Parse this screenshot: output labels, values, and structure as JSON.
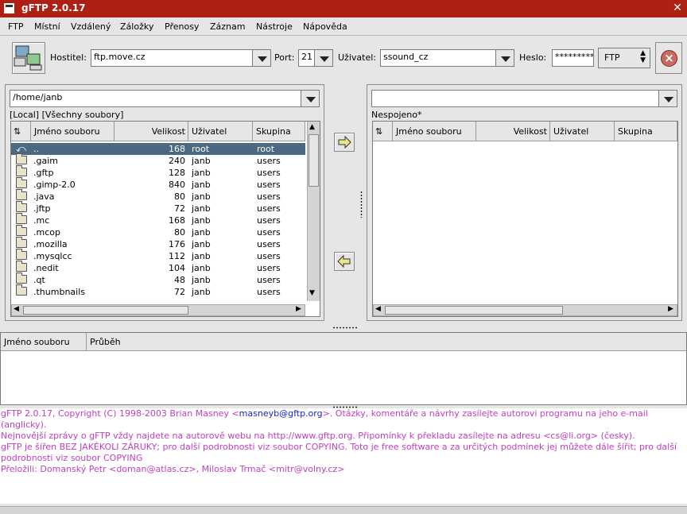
{
  "window": {
    "title": "gFTP 2.0.17"
  },
  "menu": [
    "FTP",
    "Místní",
    "Vzdálený",
    "Záložky",
    "Přenosy",
    "Záznam",
    "Nástroje",
    "Nápověda"
  ],
  "toolbar": {
    "host_label": "Hostitel:",
    "host_value": "ftp.move.cz",
    "port_label": "Port:",
    "port_value": "21",
    "user_label": "Uživatel:",
    "user_value": "ssound_cz",
    "pass_label": "Heslo:",
    "pass_value": "*********",
    "protocol": "FTP"
  },
  "local": {
    "path": "/home/janb",
    "status": "[Local] [Všechny soubory]",
    "columns": [
      "Jméno souboru",
      "Velikost",
      "Uživatel",
      "Skupina"
    ],
    "rows": [
      {
        "name": "..",
        "size": "168",
        "user": "root",
        "group": "root",
        "icon": "up-dir-icon"
      },
      {
        "name": ".gaim",
        "size": "240",
        "user": "janb",
        "group": "users",
        "icon": "folder-icon"
      },
      {
        "name": ".gftp",
        "size": "128",
        "user": "janb",
        "group": "users",
        "icon": "folder-icon"
      },
      {
        "name": ".gimp-2.0",
        "size": "840",
        "user": "janb",
        "group": "users",
        "icon": "folder-icon"
      },
      {
        "name": ".java",
        "size": "80",
        "user": "janb",
        "group": "users",
        "icon": "folder-icon"
      },
      {
        "name": ".jftp",
        "size": "72",
        "user": "janb",
        "group": "users",
        "icon": "folder-icon"
      },
      {
        "name": ".mc",
        "size": "168",
        "user": "janb",
        "group": "users",
        "icon": "folder-icon"
      },
      {
        "name": ".mcop",
        "size": "80",
        "user": "janb",
        "group": "users",
        "icon": "folder-icon"
      },
      {
        "name": ".mozilla",
        "size": "176",
        "user": "janb",
        "group": "users",
        "icon": "folder-icon"
      },
      {
        "name": ".mysqlcc",
        "size": "112",
        "user": "janb",
        "group": "users",
        "icon": "folder-icon"
      },
      {
        "name": ".nedit",
        "size": "104",
        "user": "janb",
        "group": "users",
        "icon": "folder-icon"
      },
      {
        "name": ".qt",
        "size": "48",
        "user": "janb",
        "group": "users",
        "icon": "folder-icon"
      },
      {
        "name": ".thumbnails",
        "size": "72",
        "user": "janb",
        "group": "users",
        "icon": "folder-icon"
      }
    ]
  },
  "remote": {
    "path": "",
    "status": "Nespojeno*",
    "columns": [
      "Jméno souboru",
      "Velikost",
      "Uživatel",
      "Skupina"
    ]
  },
  "transfer": {
    "columns": [
      "Jméno souboru",
      "Průběh"
    ]
  },
  "log": {
    "line1_pre": "gFTP 2.0.17, Copyright (C) 1998-2003 Brian Masney <",
    "line1_email": "masneyb@gftp.org",
    "line1_post": ">. Otázky, komentáře a návrhy zasílejte autorovi programu na jeho e-mail (anglicky).",
    "line2": "Nejnovější zprávy o gFTP vždy najdete na autorově webu na http://www.gftp.org. Připomínky k překladu zasílejte na adresu <cs@li.org> (česky).",
    "line3": "gFTP je šířen BEZ JAKÉKOLI ZÁRUKY; pro další podrobnosti viz soubor COPYING. Toto je free software a za určitých podmínek jej můžete dále šířit; pro další podrobnosti viz soubor COPYING",
    "line4": "Přeložili: Domanský Petr <doman@atlas.cz>, Miloslav Trmač <mitr@volny.cz>"
  }
}
